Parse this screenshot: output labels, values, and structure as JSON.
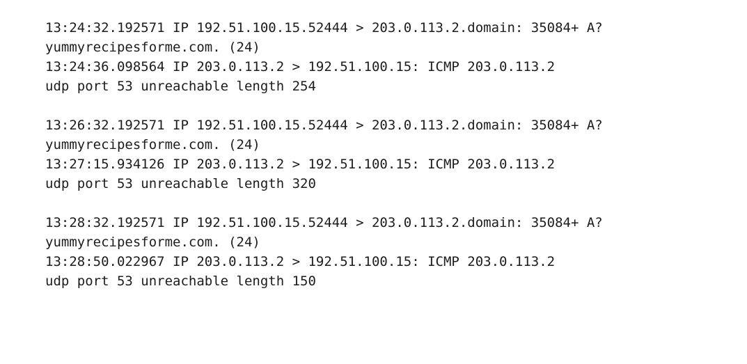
{
  "log": {
    "groups": [
      {
        "lines": [
          "13:24:32.192571 IP 192.51.100.15.52444 > 203.0.113.2.domain: 35084+ A?",
          "yummyrecipesforme.com. (24)",
          "13:24:36.098564 IP 203.0.113.2 > 192.51.100.15: ICMP 203.0.113.2",
          "udp port 53 unreachable length 254"
        ]
      },
      {
        "lines": [
          "13:26:32.192571 IP 192.51.100.15.52444 > 203.0.113.2.domain: 35084+ A?",
          "yummyrecipesforme.com. (24)",
          "13:27:15.934126 IP 203.0.113.2 > 192.51.100.15: ICMP 203.0.113.2",
          "udp port 53 unreachable length 320"
        ]
      },
      {
        "lines": [
          "13:28:32.192571 IP 192.51.100.15.52444 > 203.0.113.2.domain: 35084+ A?",
          "yummyrecipesforme.com. (24)",
          "13:28:50.022967 IP 203.0.113.2 > 192.51.100.15: ICMP 203.0.113.2",
          "udp port 53 unreachable length 150"
        ]
      }
    ]
  }
}
